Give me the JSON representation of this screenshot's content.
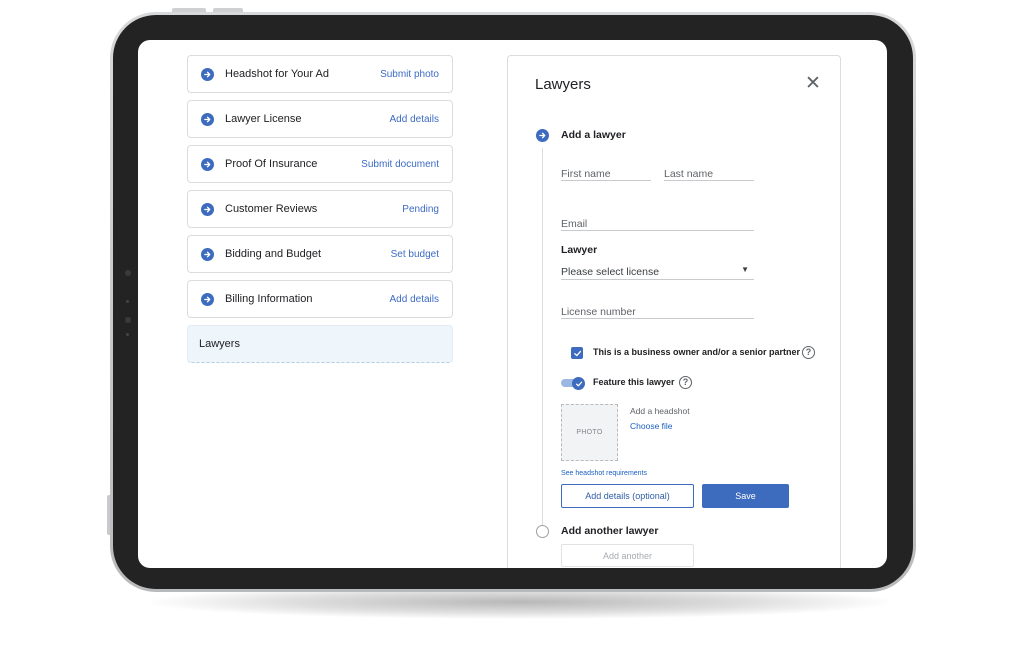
{
  "tasks": [
    {
      "label": "Headshot for Your Ad",
      "action": "Submit photo",
      "icon": "arrow-right-icon"
    },
    {
      "label": "Lawyer License",
      "action": "Add details",
      "icon": "arrow-right-icon"
    },
    {
      "label": "Proof Of Insurance",
      "action": "Submit document",
      "icon": "arrow-right-icon"
    },
    {
      "label": "Customer Reviews",
      "action": "Pending",
      "icon": "arrow-right-icon"
    },
    {
      "label": "Bidding and Budget",
      "action": "Set budget",
      "icon": "arrow-right-icon"
    },
    {
      "label": "Billing Information",
      "action": "Add details",
      "icon": "arrow-right-icon"
    },
    {
      "label": "Lawyers",
      "active": true
    }
  ],
  "panel": {
    "title": "Lawyers",
    "close_icon": "close-icon",
    "step1": {
      "title": "Add a lawyer",
      "first_name_placeholder": "First name",
      "last_name_placeholder": "Last name",
      "email_placeholder": "Email",
      "lawyer_label": "Lawyer",
      "license_select_value": "Please select license",
      "license_number_placeholder": "License number",
      "business_owner_label": "This is a business owner and/or a senior partner",
      "business_owner_checked": true,
      "feature_label": "Feature this lawyer",
      "feature_on": true,
      "photo_placeholder": "PHOTO",
      "headshot_label": "Add a headshot",
      "choose_file": "Choose file",
      "headshot_requirements": "See headshot requirements",
      "add_details_button": "Add details (optional)",
      "save_button": "Save"
    },
    "step2": {
      "title": "Add another lawyer",
      "add_another_button": "Add another"
    }
  },
  "colors": {
    "accent": "#3d6bbd",
    "link": "#3c6bc4",
    "bezel": "#232323"
  }
}
